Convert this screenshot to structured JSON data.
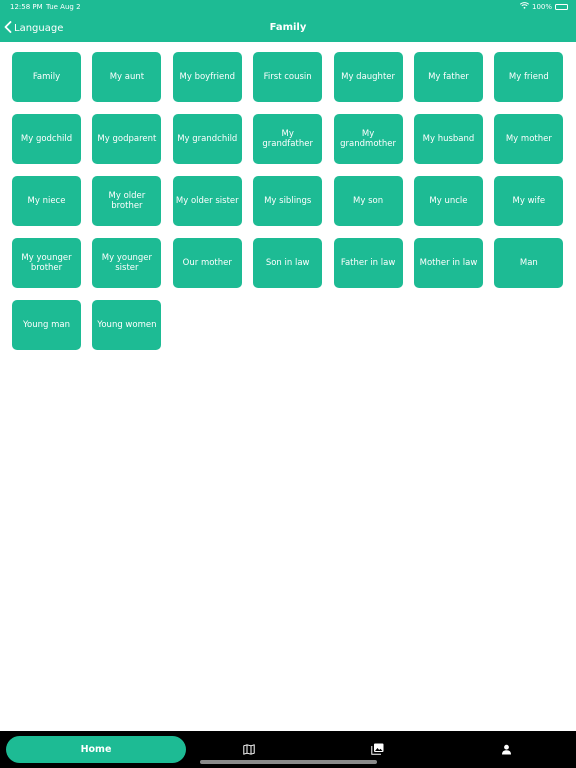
{
  "status": {
    "time": "12:58 PM",
    "date": "Tue Aug 2",
    "battery": "100%"
  },
  "nav": {
    "back_label": "Language",
    "title": "Family"
  },
  "tiles": [
    "Family",
    "My aunt",
    "My boyfriend",
    "First cousin",
    "My daughter",
    "My father",
    "My friend",
    "My godchild",
    "My godparent",
    "My grandchild",
    "My grandfather",
    "My grandmother",
    "My husband",
    "My mother",
    "My niece",
    "My older brother",
    "My older sister",
    "My siblings",
    "My son",
    "My uncle",
    "My wife",
    "My younger brother",
    "My younger sister",
    "Our mother",
    "Son in law",
    "Father in law",
    "Mother in law",
    "Man",
    "Young man",
    "Young women"
  ],
  "tabbar": {
    "home_label": "Home",
    "icons": [
      "map-icon",
      "photo-library-icon",
      "person-icon"
    ]
  },
  "colors": {
    "accent": "#1dbb94",
    "tabbar": "#000000"
  }
}
